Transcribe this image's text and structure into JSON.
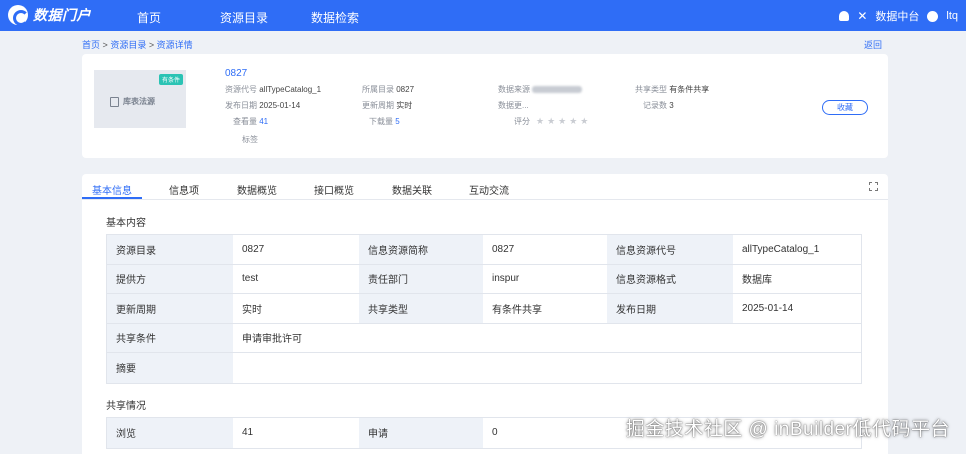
{
  "app": {
    "title": "数据门户"
  },
  "nav": {
    "items": [
      "首页",
      "资源目录",
      "数据检索"
    ]
  },
  "user": {
    "platform": "数据中台",
    "name": "ltq"
  },
  "breadcrumb": {
    "items": [
      "首页",
      "资源目录",
      "资源详情"
    ],
    "separator": ">",
    "back": "返回"
  },
  "summary": {
    "badge": "有条件",
    "thumb_label": "库表法源",
    "name": "0827",
    "fields": {
      "code_k": "资源代号",
      "code_v": "allTypeCatalog_1",
      "dir_k": "所属目录",
      "dir_v": "0827",
      "source_k": "数据来源",
      "share_k": "共享类型",
      "share_v": "有条件共享",
      "pub_k": "发布日期",
      "pub_v": "2025-01-14",
      "cycle_k": "更新周期",
      "cycle_v": "实时",
      "update_k": "数据更...",
      "records_k": "记录数",
      "records_v": "3",
      "views_k": "查看量",
      "views_v": "41",
      "downloads_k": "下载量",
      "downloads_v": "5",
      "rating_k": "评分",
      "tags_k": "标签"
    },
    "rating": {
      "stars": "★★★★★",
      "value": 0,
      "max": 5
    },
    "collect": "收藏"
  },
  "tabs": [
    "基本信息",
    "信息项",
    "数据概览",
    "接口概览",
    "数据关联",
    "互动交流"
  ],
  "basic": {
    "title": "基本内容",
    "rows": [
      [
        "资源目录",
        "0827",
        "信息资源简称",
        "0827",
        "信息资源代号",
        "allTypeCatalog_1"
      ],
      [
        "提供方",
        "test",
        "责任部门",
        "inspur",
        "信息资源格式",
        "数据库"
      ],
      [
        "更新周期",
        "实时",
        "共享类型",
        "有条件共享",
        "发布日期",
        "2025-01-14"
      ]
    ],
    "condition": [
      "共享条件",
      "申请审批许可"
    ],
    "summary": [
      "摘要",
      ""
    ]
  },
  "share": {
    "title": "共享情况",
    "row": [
      "浏览",
      "41",
      "申请",
      "0"
    ]
  },
  "watermark": "掘金技术社区 @ inBuilder低代码平台",
  "colors": {
    "primary": "#2f6df6",
    "label_bg": "#eef2f8",
    "badge": "#2bc3b4"
  }
}
